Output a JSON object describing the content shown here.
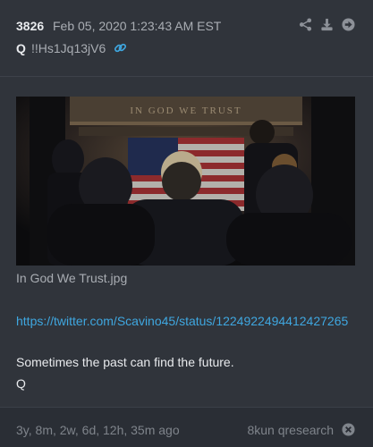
{
  "post": {
    "number": "3826",
    "date": "Feb 05, 2020 1:23:43 AM EST",
    "author": "Q",
    "tripcode": "!!Hs1Jq13jV6",
    "icons": [
      "share-icon",
      "download-icon",
      "arrow-right-circle-icon",
      "link-icon"
    ]
  },
  "image": {
    "filename": "In God We Trust.jpg",
    "inscription": "IN GOD WE TRUST"
  },
  "body": {
    "link": "https://twitter.com/Scavino45/status/1224922494412427265",
    "message": "Sometimes the past can find the future.",
    "signature": "Q"
  },
  "footer": {
    "age": "3y, 8m, 2w, 6d, 12h, 35m ago",
    "board": "8kun qresearch",
    "icons": [
      "close-icon"
    ]
  },
  "colors": {
    "background": "#30343b",
    "link": "#3fa7e0",
    "muted_text": "#a9adb3",
    "footer_text": "#7f848b"
  }
}
